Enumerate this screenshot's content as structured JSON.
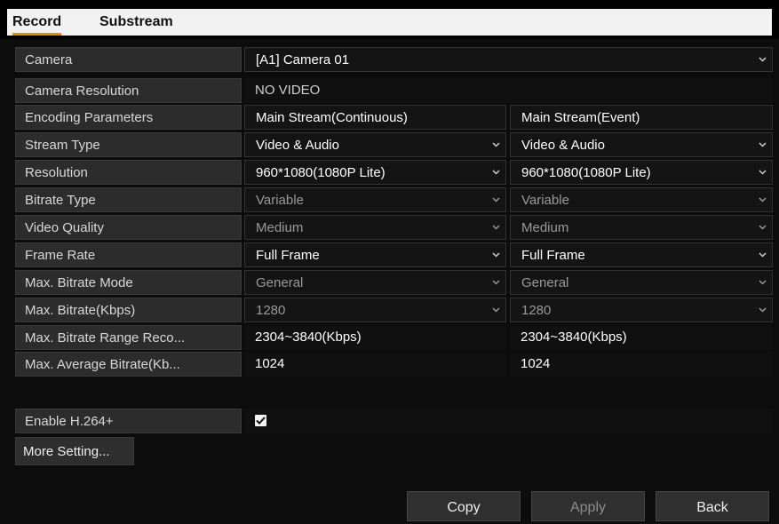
{
  "tabs": {
    "record": "Record",
    "substream": "Substream"
  },
  "camera": {
    "label": "Camera",
    "value": "[A1] Camera 01"
  },
  "camera_resolution": {
    "label": "Camera Resolution",
    "value": "NO VIDEO"
  },
  "encoding": {
    "label": "Encoding Parameters",
    "main": "Main Stream(Continuous)",
    "event": "Main Stream(Event)"
  },
  "stream_type": {
    "label": "Stream Type",
    "main": "Video & Audio",
    "event": "Video & Audio"
  },
  "resolution": {
    "label": "Resolution",
    "main": "960*1080(1080P Lite)",
    "event": "960*1080(1080P Lite)"
  },
  "bitrate_type": {
    "label": "Bitrate Type",
    "main": "Variable",
    "event": "Variable"
  },
  "video_quality": {
    "label": "Video Quality",
    "main": "Medium",
    "event": "Medium"
  },
  "frame_rate": {
    "label": "Frame Rate",
    "main": "Full Frame",
    "event": "Full Frame"
  },
  "max_bitrate_mode": {
    "label": "Max. Bitrate Mode",
    "main": "General",
    "event": "General"
  },
  "max_bitrate": {
    "label": "Max. Bitrate(Kbps)",
    "main": "1280",
    "event": "1280"
  },
  "max_bitrate_range": {
    "label": "Max. Bitrate Range Reco...",
    "main": "2304~3840(Kbps)",
    "event": "2304~3840(Kbps)"
  },
  "max_avg_bitrate": {
    "label": "Max. Average Bitrate(Kb...",
    "main": "1024",
    "event": "1024"
  },
  "h264plus": {
    "label": "Enable H.264+",
    "checked": true
  },
  "buttons": {
    "more": "More Setting...",
    "copy": "Copy",
    "apply": "Apply",
    "back": "Back"
  }
}
